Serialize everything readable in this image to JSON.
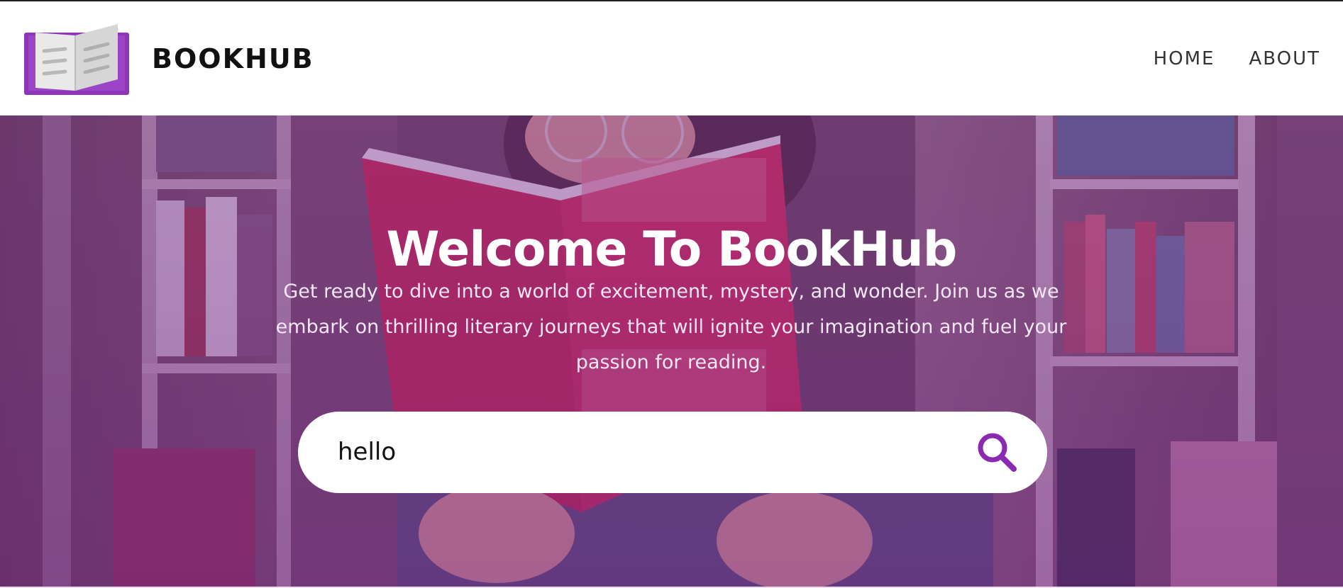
{
  "header": {
    "brand": "BOOKHUB",
    "logo_icon": "open-book-icon",
    "nav": [
      {
        "label": "HOME"
      },
      {
        "label": "ABOUT"
      }
    ]
  },
  "hero": {
    "title": "Welcome To BookHub",
    "subtitle": "Get ready to dive into a world of excitement, mystery, and wonder. Join us as we embark on thrilling literary journeys that will ignite your imagination and fuel your passion for reading.",
    "overlay_color": "#8a3aa0",
    "background_image": "woman-reading-red-book-in-library"
  },
  "search": {
    "value": "hello",
    "icon": "search-icon",
    "accent_color": "#8a2ab0"
  }
}
